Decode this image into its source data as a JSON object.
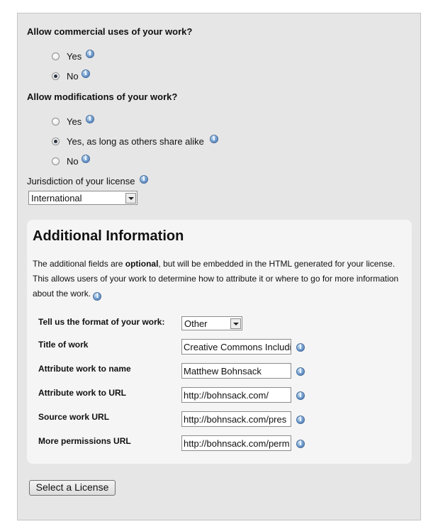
{
  "commercial": {
    "question": "Allow commercial uses of your work?",
    "options": [
      {
        "label": "Yes",
        "selected": false
      },
      {
        "label": "No",
        "selected": true
      }
    ]
  },
  "modifications": {
    "question": "Allow modifications of your work?",
    "options": [
      {
        "label": "Yes",
        "selected": false
      },
      {
        "label": "Yes, as long as others share alike",
        "selected": true
      },
      {
        "label": "No",
        "selected": false
      }
    ]
  },
  "jurisdiction": {
    "label": "Jurisdiction of your license",
    "selected": "International"
  },
  "additional": {
    "title": "Additional Information",
    "intro_before": "The additional fields are ",
    "intro_bold": "optional",
    "intro_after": ", but will be embedded in the HTML generated for your license. This allows users of your work to determine how to attribute it or where to go for more information about the work.",
    "fields": {
      "format_label": "Tell us the format of your work:",
      "format_value": "Other",
      "title_label": "Title of work",
      "title_value": "Creative Commons Includi",
      "attr_name_label": "Attribute work to name",
      "attr_name_value": "Matthew Bohnsack",
      "attr_url_label": "Attribute work to URL",
      "attr_url_value": "http://bohnsack.com/",
      "source_label": "Source work URL",
      "source_value": "http://bohnsack.com/pres",
      "more_label": "More permissions URL",
      "more_value": "http://bohnsack.com/perm"
    }
  },
  "submit_label": "Select a License",
  "icons": {
    "info": "info-icon",
    "info_glyph": "i"
  },
  "colors": {
    "panel": "#e6e6e6",
    "box": "#f5f5f5",
    "info": "#5b8ac4"
  }
}
